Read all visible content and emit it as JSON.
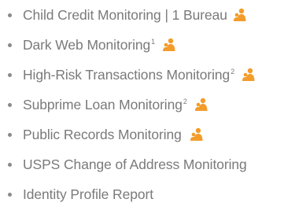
{
  "accent_color": "#f39c2b",
  "features": [
    {
      "label": "Child Credit Monitoring | 1 Bureau",
      "sup": "",
      "icon": "family-icon"
    },
    {
      "label": "Dark Web Monitoring",
      "sup": "1",
      "icon": "family-icon"
    },
    {
      "label": "High-Risk Transactions Monitoring",
      "sup": "2",
      "icon": "family-icon"
    },
    {
      "label": "Subprime Loan Monitoring",
      "sup": "2",
      "icon": "family-icon"
    },
    {
      "label": "Public Records Monitoring",
      "sup": "",
      "icon": "family-icon"
    },
    {
      "label": "USPS Change of Address Monitoring",
      "sup": "",
      "icon": ""
    },
    {
      "label": "Identity Profile Report",
      "sup": "",
      "icon": ""
    }
  ]
}
